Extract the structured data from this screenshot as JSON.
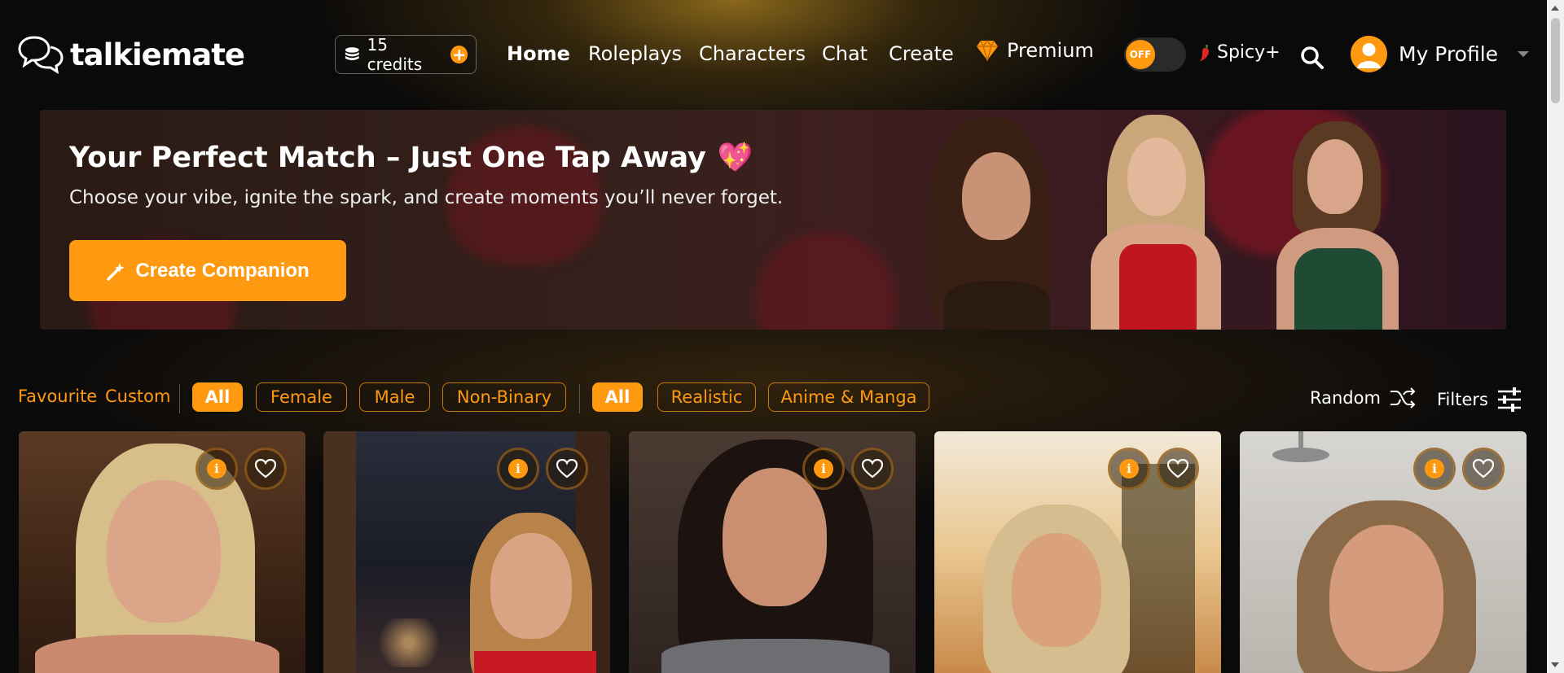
{
  "app": {
    "name": "talkiemate"
  },
  "credits": {
    "label": "15 credits",
    "add": "+"
  },
  "nav": {
    "home": "Home",
    "roleplays": "Roleplays",
    "characters": "Characters",
    "chat": "Chat",
    "create": "Create",
    "premium": "Premium"
  },
  "toggle": {
    "state": "OFF"
  },
  "spicy": {
    "label": "Spicy+"
  },
  "profile": {
    "label": "My Profile"
  },
  "hero": {
    "title": "Your Perfect Match – Just One Tap Away",
    "emoji": "💖",
    "subtitle": "Choose your vibe, ignite the spark, and create moments you’ll never forget.",
    "cta": "Create Companion"
  },
  "filters": {
    "favourite": "Favourite",
    "custom": "Custom",
    "gender": [
      "All",
      "Female",
      "Male",
      "Non-Binary"
    ],
    "style": [
      "All",
      "Realistic",
      "Anime & Manga"
    ],
    "random": "Random",
    "filters": "Filters"
  },
  "colors": {
    "accent": "#ff9a10",
    "background": "#0b0a0a"
  },
  "cards": [
    {
      "id": "card-1"
    },
    {
      "id": "card-2"
    },
    {
      "id": "card-3"
    },
    {
      "id": "card-4"
    },
    {
      "id": "card-5"
    }
  ],
  "icons": {
    "logo": "chat-bubbles-icon",
    "coins": "coins-icon",
    "premium": "diamond-icon",
    "spicy": "chili-pepper-icon",
    "search": "search-icon",
    "avatar": "user-avatar-icon",
    "cta": "magic-wand-icon",
    "random": "shuffle-icon",
    "filters": "sliders-icon",
    "info": "info-icon",
    "favorite": "heart-icon"
  }
}
